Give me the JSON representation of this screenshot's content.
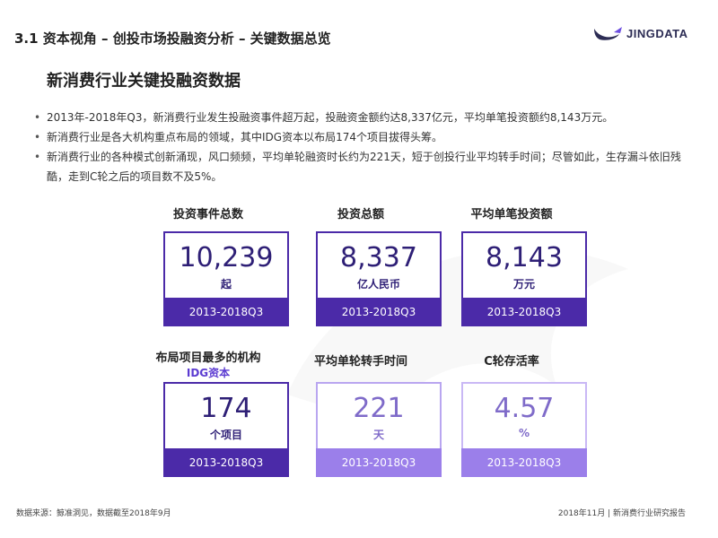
{
  "header": {
    "section_title": "3.1 资本视角 – 创投市场投融资分析 – 关键数据总览",
    "logo_text": "JINGDATA"
  },
  "subtitle": "新消费行业关键投融资数据",
  "bullets": [
    "2013年-2018年Q3，新消费行业发生投融资事件超万起，投融资金额约达8,337亿元，平均单笔投资额约8,143万元。",
    "新消费行业是各大机构重点布局的领域，其中IDG资本以布局174个项目拔得头筹。",
    "新消费行业的各种模式创新涌现，风口频频，平均单轮融资时长约为221天，短于创投行业平均转手时间；尽管如此，生存漏斗依旧残酷，走到C轮之后的项目数不及5%。"
  ],
  "cards": [
    {
      "label": "投资事件总数",
      "highlight": "",
      "value": "10,239",
      "unit": "起",
      "period": "2013-2018Q3"
    },
    {
      "label": "投资总额",
      "highlight": "",
      "value": "8,337",
      "unit": "亿人民币",
      "period": "2013-2018Q3"
    },
    {
      "label": "平均单笔投资额",
      "highlight": "",
      "value": "8,143",
      "unit": "万元",
      "period": "2013-2018Q3"
    },
    {
      "label": "布局项目最多的机构",
      "highlight": "IDG资本",
      "value": "174",
      "unit": "个项目",
      "period": "2013-2018Q3"
    },
    {
      "label": "平均单轮转手时间",
      "highlight": "",
      "value": "221",
      "unit": "天",
      "period": "2013-2018Q3"
    },
    {
      "label": "C轮存活率",
      "highlight": "",
      "value": "4.57",
      "unit": "%",
      "period": "2013-2018Q3"
    }
  ],
  "footer": {
    "source": "数据来源：鲸准洞见，数据截至2018年9月",
    "report": "2018年11月 | 新消费行业研究报告"
  },
  "colors": {
    "primary": "#4b2aa8",
    "light": "#9b7fea",
    "value_dark": "#2e1f76"
  }
}
